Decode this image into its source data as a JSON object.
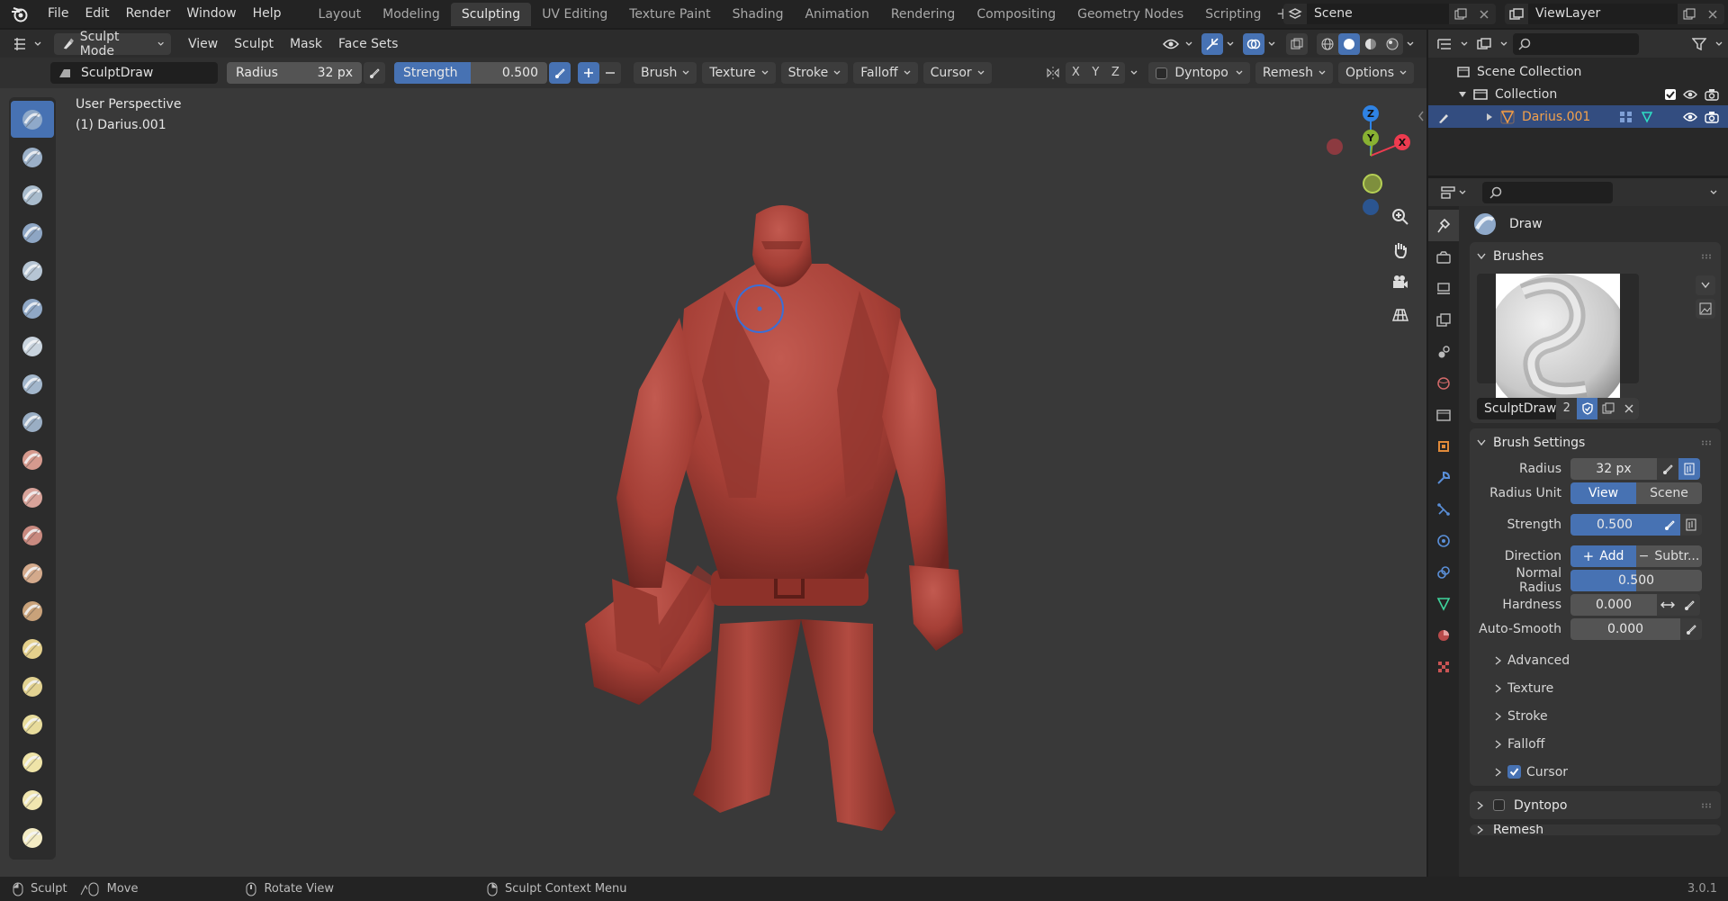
{
  "menubar": {
    "items": [
      "File",
      "Edit",
      "Render",
      "Window",
      "Help"
    ],
    "workspaces": [
      "Layout",
      "Modeling",
      "Sculpting",
      "UV Editing",
      "Texture Paint",
      "Shading",
      "Animation",
      "Rendering",
      "Compositing",
      "Geometry Nodes",
      "Scripting"
    ],
    "active_workspace": "Sculpting",
    "scene": "Scene",
    "view_layer": "ViewLayer"
  },
  "viewport_header": {
    "mode": "Sculpt Mode",
    "menus": [
      "View",
      "Sculpt",
      "Mask",
      "Face Sets"
    ]
  },
  "tool_settings": {
    "brush_name": "SculptDraw",
    "radius_label": "Radius",
    "radius_value": "32 px",
    "strength_label": "Strength",
    "strength_value": "0.500",
    "strength_fraction": 0.5,
    "menus": [
      "Brush",
      "Texture",
      "Stroke",
      "Falloff",
      "Cursor"
    ],
    "axes": [
      "X",
      "Y",
      "Z"
    ],
    "dyntopo": "Dyntopo",
    "remesh": "Remesh",
    "options": "Options"
  },
  "viewport": {
    "perspective": "User Perspective",
    "object": "(1) Darius.001",
    "gizmo_axes": [
      "Z",
      "Y",
      "X"
    ],
    "colors": {
      "x": "#ee3b4f",
      "y": "#88b132",
      "z": "#2f83e4",
      "model": "#a53f36"
    }
  },
  "tools": [
    "draw-icon",
    "draw-sharp-icon",
    "clay-icon",
    "clay-strips-icon",
    "clay-thumb-icon",
    "layer-icon",
    "inflate-icon",
    "blob-icon",
    "crease-icon",
    "smooth-icon",
    "flatten-icon",
    "fill-icon",
    "scrape-icon",
    "multiplane-scrape-icon",
    "pinch-icon",
    "grab-icon",
    "elastic-deform-icon",
    "snake-hook-icon",
    "thumb-icon",
    "pose-icon"
  ],
  "outliner": {
    "root": "Scene Collection",
    "collection": "Collection",
    "object": "Darius.001"
  },
  "properties": {
    "header_tool": "Draw",
    "brushes_panel": "Brushes",
    "brush_name": "SculptDraw",
    "brush_users": "2",
    "brush_settings_panel": "Brush Settings",
    "radius_label": "Radius",
    "radius_value": "32 px",
    "radius_unit_label": "Radius Unit",
    "radius_unit_options": [
      "View",
      "Scene"
    ],
    "strength_label": "Strength",
    "strength_value": "0.500",
    "direction_label": "Direction",
    "direction_options": [
      "Add",
      "Subtr..."
    ],
    "normal_radius_label": "Normal Radius",
    "normal_radius_value": "0.500",
    "normal_radius_fraction": 0.5,
    "hardness_label": "Hardness",
    "hardness_value": "0.000",
    "autosmooth_label": "Auto-Smooth",
    "autosmooth_value": "0.000",
    "subpanels": [
      "Advanced",
      "Texture",
      "Stroke",
      "Falloff",
      "Cursor"
    ],
    "cursor_checked": true,
    "dyntopo_panel": "Dyntopo",
    "next_panel": "Remesh"
  },
  "statusbar": {
    "items": [
      "Sculpt",
      "Move",
      "Rotate View",
      "Sculpt Context Menu"
    ],
    "version": "3.0.1"
  }
}
